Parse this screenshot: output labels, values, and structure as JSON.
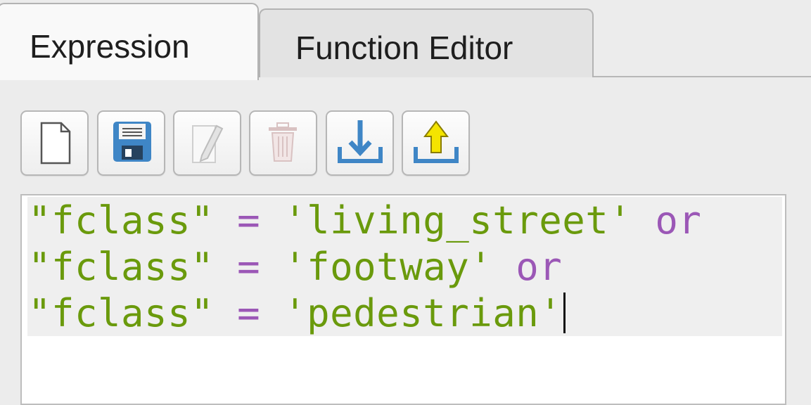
{
  "tabs": [
    {
      "label": "Expression",
      "active": true
    },
    {
      "label": "Function Editor",
      "active": false
    }
  ],
  "toolbar": {
    "buttons": [
      {
        "icon": "new-file-icon",
        "enabled": true
      },
      {
        "icon": "save-icon",
        "enabled": true
      },
      {
        "icon": "edit-icon",
        "enabled": false
      },
      {
        "icon": "delete-icon",
        "enabled": false
      },
      {
        "icon": "import-icon",
        "enabled": true
      },
      {
        "icon": "export-icon",
        "enabled": true
      }
    ]
  },
  "editor": {
    "lines": [
      {
        "field": "\"fclass\"",
        "op": " = ",
        "value": "'living_street'",
        "keyword": " or"
      },
      {
        "field": "\"fclass\"",
        "op": " = ",
        "value": "'footway'",
        "keyword": " or"
      },
      {
        "field": "\"fclass\"",
        "op": " = ",
        "value": "'pedestrian'",
        "keyword": ""
      }
    ]
  },
  "colors": {
    "string": "#6a9a0c",
    "keyword": "#9b57b6",
    "accent_blue": "#3f86c6",
    "accent_yellow": "#f4e400"
  }
}
